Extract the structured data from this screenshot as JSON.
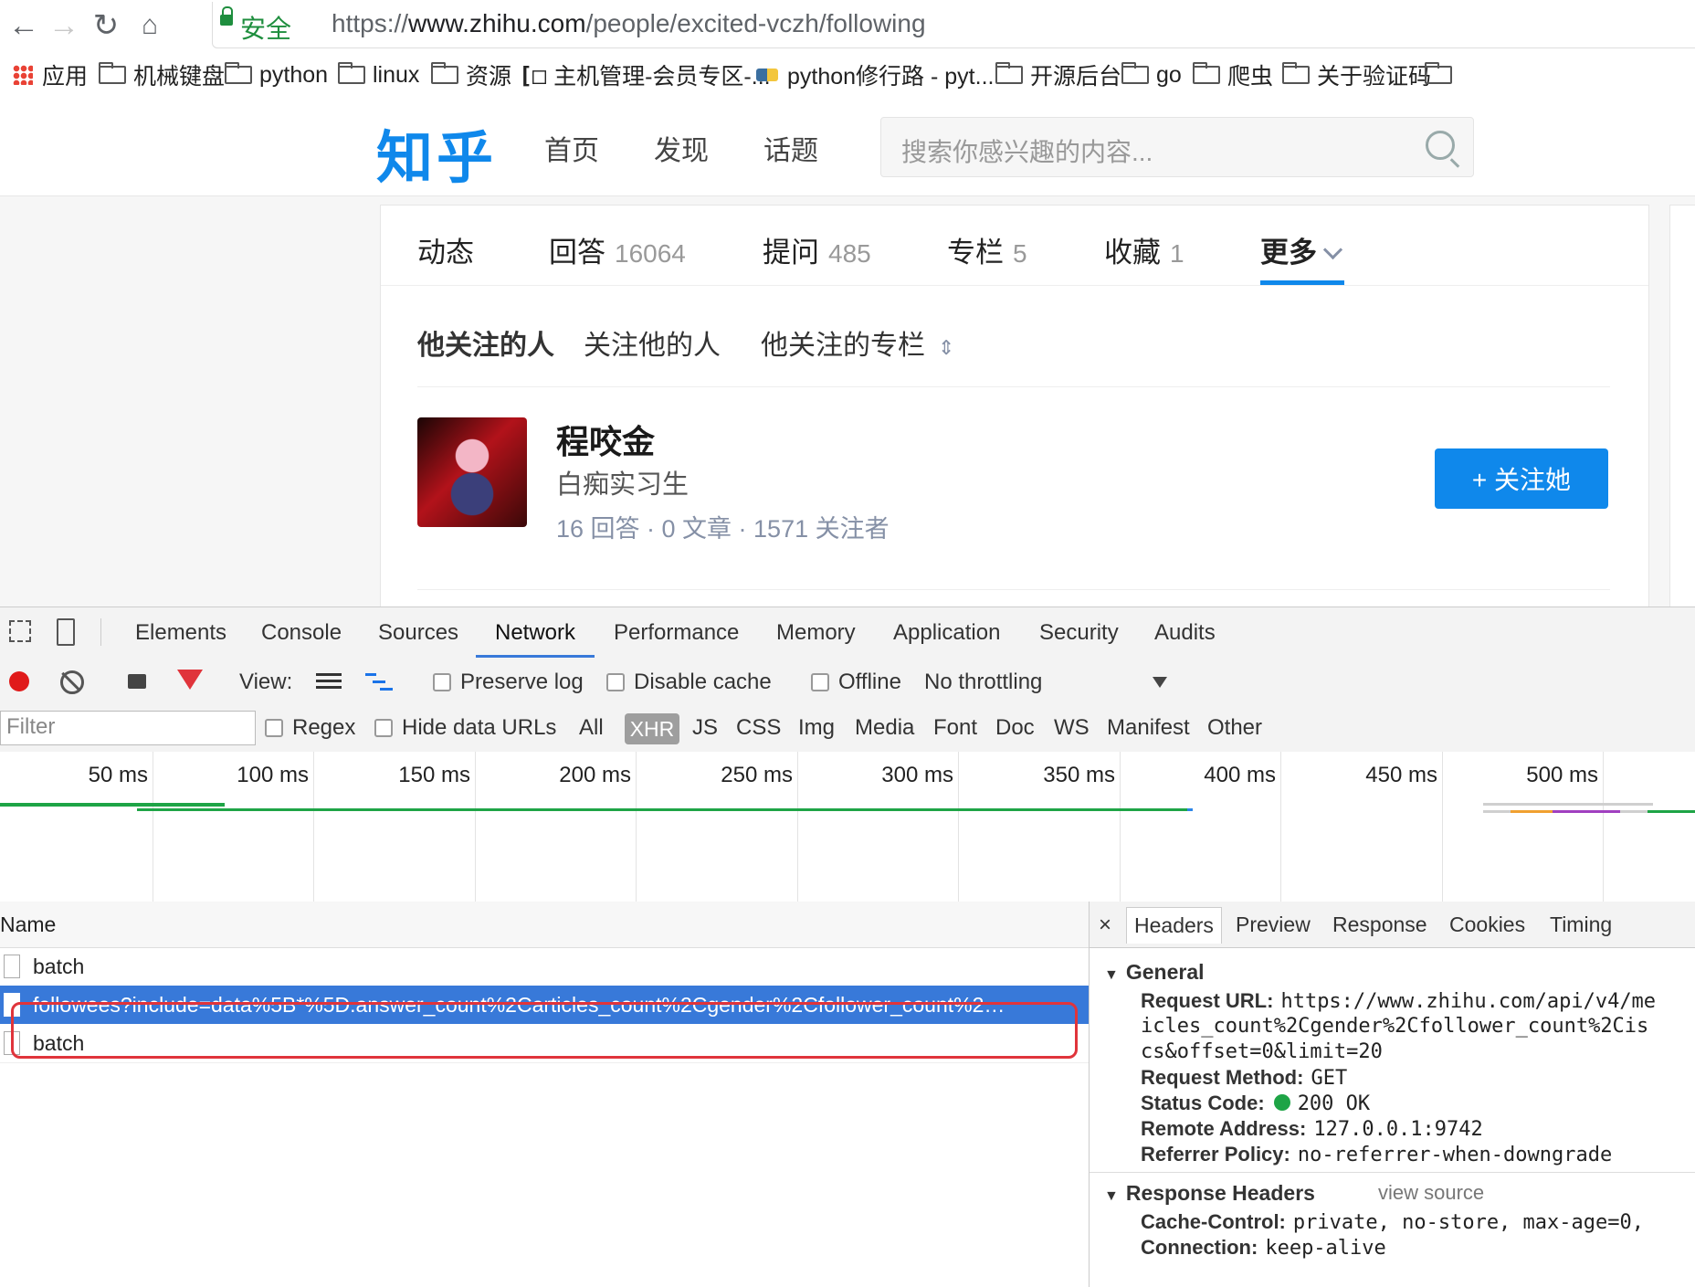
{
  "browser": {
    "secure_label": "安全",
    "url_scheme": "https://",
    "url_host": "www.zhihu.com",
    "url_path": "/people/excited-vczh/following",
    "bookmarks": [
      "应用",
      "机械键盘",
      "python",
      "linux",
      "资源",
      "主机管理-会员专区-...",
      "python修行路 - pyt...",
      "开源后台",
      "go",
      "爬虫",
      "关于验证码"
    ]
  },
  "zhihu": {
    "logo": "知乎",
    "nav": [
      "首页",
      "发现",
      "话题"
    ],
    "search_placeholder": "搜索你感兴趣的内容...",
    "profile_tabs": [
      {
        "label": "动态",
        "count": ""
      },
      {
        "label": "回答",
        "count": "16064"
      },
      {
        "label": "提问",
        "count": "485"
      },
      {
        "label": "专栏",
        "count": "5"
      },
      {
        "label": "收藏",
        "count": "1"
      },
      {
        "label": "更多",
        "count": ""
      }
    ],
    "sub_tabs": [
      "他关注的人",
      "关注他的人",
      "他关注的专栏"
    ],
    "user": {
      "name": "程咬金",
      "bio": "白痴实习生",
      "stats": "16 回答 · 0 文章 · 1571 关注者",
      "follow_label": "+ 关注她"
    }
  },
  "devtools": {
    "tabs": [
      "Elements",
      "Console",
      "Sources",
      "Network",
      "Performance",
      "Memory",
      "Application",
      "Security",
      "Audits"
    ],
    "active_tab": "Network",
    "toolbar": {
      "view_label": "View:",
      "preserve_log": "Preserve log",
      "disable_cache": "Disable cache",
      "offline": "Offline",
      "throttling": "No throttling"
    },
    "filter": {
      "placeholder": "Filter",
      "regex": "Regex",
      "hide_data_urls": "Hide data URLs",
      "types": [
        "All",
        "XHR",
        "JS",
        "CSS",
        "Img",
        "Media",
        "Font",
        "Doc",
        "WS",
        "Manifest",
        "Other"
      ],
      "active_type": "XHR"
    },
    "timeline_ticks": [
      "50 ms",
      "100 ms",
      "150 ms",
      "200 ms",
      "250 ms",
      "300 ms",
      "350 ms",
      "400 ms",
      "450 ms",
      "500 ms"
    ],
    "name_header": "Name",
    "requests": [
      "batch",
      "followees?include=data%5B*%5D.answer_count%2Carticles_count%2Cgender%2Cfollower_count%2…",
      "batch"
    ],
    "detail": {
      "tabs": [
        "Headers",
        "Preview",
        "Response",
        "Cookies",
        "Timing"
      ],
      "general_title": "General",
      "request_url_label": "Request URL:",
      "request_url_1": "https://www.zhihu.com/api/v4/me",
      "request_url_2": "icles_count%2Cgender%2Cfollower_count%2Cis",
      "request_url_3": "cs&offset=0&limit=20",
      "method_label": "Request Method:",
      "method": "GET",
      "status_label": "Status Code:",
      "status": "200  OK",
      "status_color": "#1ea446",
      "remote_label": "Remote Address:",
      "remote": "127.0.0.1:9742",
      "referrer_label": "Referrer Policy:",
      "referrer": "no-referrer-when-downgrade",
      "response_title": "Response Headers",
      "view_source": "view source",
      "cache_label": "Cache-Control:",
      "cache": "private, no-store, max-age=0,",
      "connection_label": "Connection:",
      "connection": "keep-alive"
    }
  }
}
